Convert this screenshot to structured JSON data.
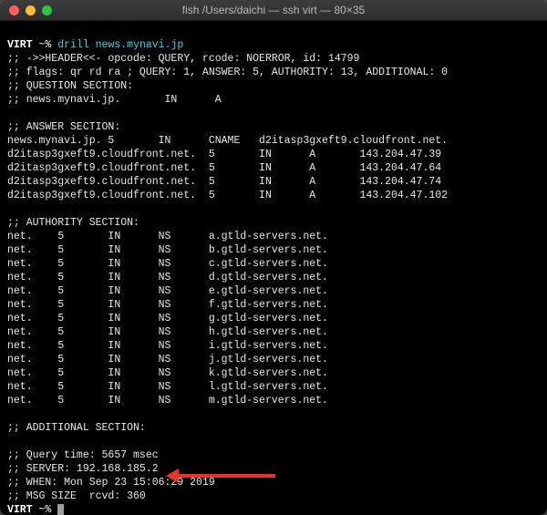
{
  "window": {
    "title": "fish  /Users/daichi — ssh virt — 80×35"
  },
  "prompt": {
    "host": "VIRT",
    "sep": "~%",
    "cmd_name": "drill",
    "cmd_arg": "news.mynavi.jp"
  },
  "header": {
    "line1": ";; ->>HEADER<<- opcode: QUERY, rcode: NOERROR, id: 14799",
    "line2": ";; flags: qr rd ra ; QUERY: 1, ANSWER: 5, AUTHORITY: 13, ADDITIONAL: 0"
  },
  "question": {
    "title": ";; QUESTION SECTION:",
    "row": ";; news.mynavi.jp.       IN      A"
  },
  "answer": {
    "title": ";; ANSWER SECTION:",
    "rows": [
      "news.mynavi.jp. 5       IN      CNAME   d2itasp3gxeft9.cloudfront.net.",
      "d2itasp3gxeft9.cloudfront.net.  5       IN      A       143.204.47.39",
      "d2itasp3gxeft9.cloudfront.net.  5       IN      A       143.204.47.64",
      "d2itasp3gxeft9.cloudfront.net.  5       IN      A       143.204.47.74",
      "d2itasp3gxeft9.cloudfront.net.  5       IN      A       143.204.47.102"
    ]
  },
  "authority": {
    "title": ";; AUTHORITY SECTION:",
    "rows": [
      "net.    5       IN      NS      a.gtld-servers.net.",
      "net.    5       IN      NS      b.gtld-servers.net.",
      "net.    5       IN      NS      c.gtld-servers.net.",
      "net.    5       IN      NS      d.gtld-servers.net.",
      "net.    5       IN      NS      e.gtld-servers.net.",
      "net.    5       IN      NS      f.gtld-servers.net.",
      "net.    5       IN      NS      g.gtld-servers.net.",
      "net.    5       IN      NS      h.gtld-servers.net.",
      "net.    5       IN      NS      i.gtld-servers.net.",
      "net.    5       IN      NS      j.gtld-servers.net.",
      "net.    5       IN      NS      k.gtld-servers.net.",
      "net.    5       IN      NS      l.gtld-servers.net.",
      "net.    5       IN      NS      m.gtld-servers.net."
    ]
  },
  "additional": {
    "title": ";; ADDITIONAL SECTION:"
  },
  "footer": {
    "query_time": ";; Query time: 5657 msec",
    "server": ";; SERVER: 192.168.185.2",
    "when": ";; WHEN: Mon Sep 23 15:06:29 2019",
    "msg_size": ";; MSG SIZE  rcvd: 360"
  }
}
